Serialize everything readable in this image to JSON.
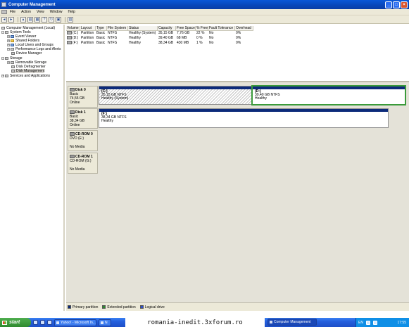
{
  "window": {
    "title": "Computer Management"
  },
  "menu": [
    "File",
    "Action",
    "View",
    "Window",
    "Help"
  ],
  "toolbar": {
    "icons": [
      "back-icon",
      "forward-icon",
      "up-icon",
      "show-hide-tree-icon",
      "properties-icon",
      "help-icon",
      "refresh-icon",
      "export-icon",
      "view-icon"
    ]
  },
  "tree": {
    "root": "Computer Management (Local)",
    "system_tools": "System Tools",
    "event_viewer": "Event Viewer",
    "shared_folders": "Shared Folders",
    "local_users": "Local Users and Groups",
    "perf_logs": "Performance Logs and Alerts",
    "device_manager": "Device Manager",
    "storage": "Storage",
    "removable": "Removable Storage",
    "defrag": "Disk Defragmenter",
    "disk_mgmt": "Disk Management",
    "services": "Services and Applications"
  },
  "volumes": {
    "headers": [
      "Volume",
      "Layout",
      "Type",
      "File System",
      "Status",
      "Capacity",
      "Free Space",
      "% Free",
      "Fault Tolerance",
      "Overhead"
    ],
    "rows": [
      [
        "(C:)",
        "Partition",
        "Basic",
        "NTFS",
        "Healthy (System)",
        "35,15 GB",
        "7,76 GB",
        "22 %",
        "No",
        "0%"
      ],
      [
        "(D:)",
        "Partition",
        "Basic",
        "NTFS",
        "Healthy",
        "39,40 GB",
        "68 MB",
        "0 %",
        "No",
        "0%"
      ],
      [
        "(F:)",
        "Partition",
        "Basic",
        "NTFS",
        "Healthy",
        "38,34 GB",
        "430 MB",
        "1 %",
        "No",
        "0%"
      ]
    ]
  },
  "disks": {
    "disk0": {
      "name": "Disk 0",
      "type": "Basic",
      "size": "74,55 GB",
      "state": "Online"
    },
    "disk1": {
      "name": "Disk 1",
      "type": "Basic",
      "size": "38,34 GB",
      "state": "Online"
    },
    "cd0": {
      "name": "CD-ROM 0",
      "type": "DVD (E:)",
      "media": "No Media"
    },
    "cd1": {
      "name": "CD-ROM 1",
      "type": "CD-ROM (G:)",
      "media": "No Media"
    }
  },
  "partitions": {
    "c": {
      "label": "(C:)",
      "size": "35,15 GB NTFS",
      "status": "Healthy (System)"
    },
    "d": {
      "label": "(D:)",
      "size": "39,40 GB NTFS",
      "status": "Healthy"
    },
    "f": {
      "label": "(F:)",
      "size": "38,34 GB NTFS",
      "status": "Healthy"
    }
  },
  "legend": {
    "primary": "Primary partition",
    "extended": "Extended partition",
    "logical": "Logical drive",
    "colors": {
      "primary": "#0c2a7a",
      "extended": "#2f8a2f",
      "logical": "#3050c8"
    }
  },
  "taskbar": {
    "start": "start",
    "tasks": [
      "Yahoo! - Microsoft In...",
      "N"
    ],
    "active_task": "Computer Management",
    "watermark": "romania-inedit.3xforum.ro",
    "lang": "EN",
    "clock": "17:55"
  }
}
